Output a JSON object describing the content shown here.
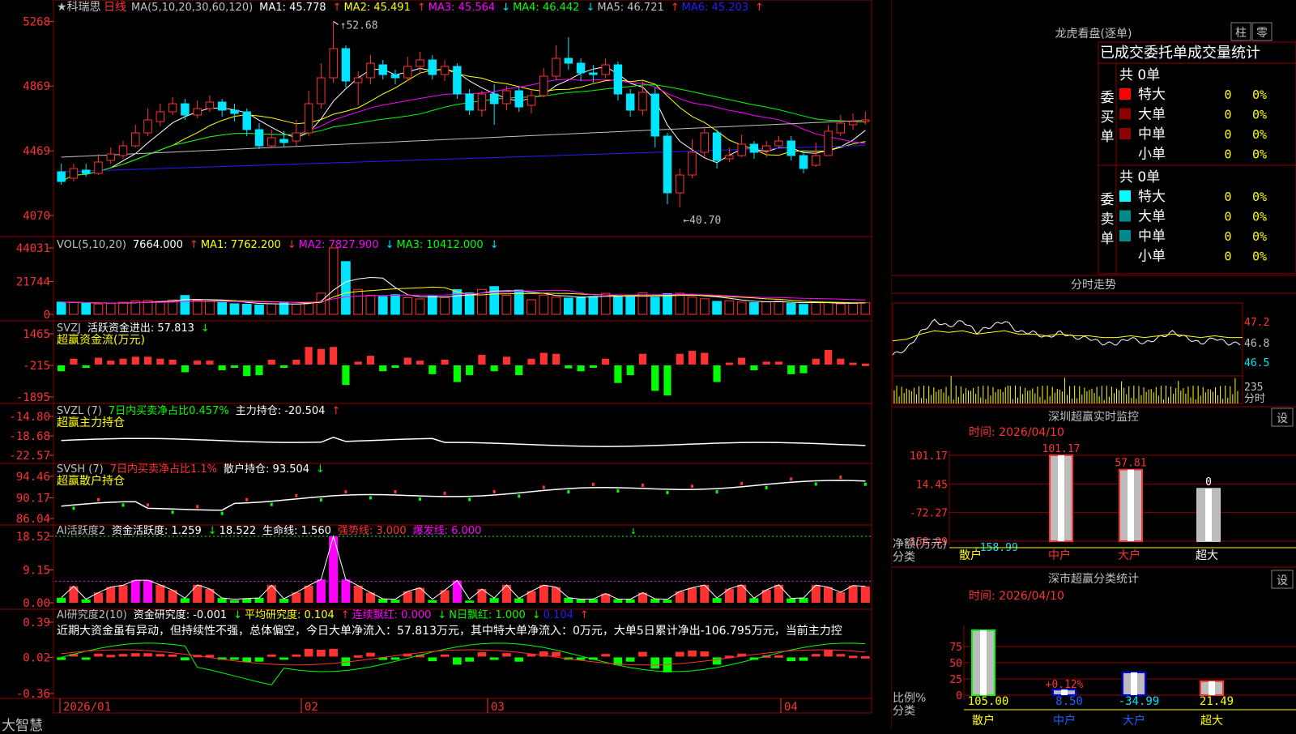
{
  "stock": {
    "name": "★科瑞思",
    "period": "日线"
  },
  "brand": "大智慧",
  "colors": {
    "up": "#ff3232",
    "down": "#00e5ff",
    "ma1": "#ffffff",
    "ma2": "#ffff00",
    "ma3": "#ff00ff",
    "ma4": "#00ff00",
    "ma5": "#c0c0c0",
    "ma6": "#2020ff",
    "grid": "#8b0000",
    "axis": "#ff3232",
    "yellow": "#ffff00",
    "green": "#00ff00"
  },
  "price_panel": {
    "legend": [
      "MA(5,10,20,30,60,120)",
      "MA1: 45.778",
      "↑",
      "MA2: 45.491",
      "↑",
      "MA3: 45.564",
      "↓",
      "MA4: 46.442",
      "↓",
      "MA5: 46.721",
      "↑",
      "MA6: 45.203",
      "↑"
    ],
    "ticks": [
      "5268",
      "4869",
      "4469",
      "4070"
    ],
    "high_label": "52.68",
    "low_label": "40.70"
  },
  "vol_panel": {
    "legend": [
      "VOL(5,10,20)",
      "7664.000",
      "↑",
      "MA1: 7762.200",
      "↓",
      "MA2: 7827.900",
      "↓",
      "MA3: 10412.000",
      "↓"
    ],
    "ticks": [
      "44031",
      "21744",
      "0"
    ]
  },
  "svzj_panel": {
    "legend": [
      "SVZJ",
      "活跃资金进出: 57.813",
      "↓"
    ],
    "sub": "超赢资金流(万元)",
    "ticks": [
      "1465",
      "-215",
      "-1895"
    ]
  },
  "svzl_panel": {
    "legend": [
      "SVZL (7)",
      "7日内买卖净占比0.457%",
      "主力持仓: -20.504",
      "↑"
    ],
    "sub": "超赢主力持仓",
    "ticks": [
      "-14.80",
      "-18.68",
      "-22.57"
    ]
  },
  "svsh_panel": {
    "legend": [
      "SVSH (7)",
      "7日内买卖净占比1.1%",
      "散户持仓: 93.504",
      "↓"
    ],
    "sub": "超赢散户持仓",
    "ticks": [
      "94.46",
      "90.17",
      "86.04"
    ]
  },
  "ai_panel": {
    "legend": [
      "AI活跃度2",
      "资金活跃度: 1.259",
      "↓",
      "18.522",
      "生命线: 1.560",
      "强势线: 3.000",
      "爆发线: 6.000"
    ],
    "ticks": [
      "18.52",
      "9.15",
      "0.00"
    ]
  },
  "research_panel": {
    "legend": [
      "AI研究度2(10)",
      "资金研究度: -0.001",
      "↓",
      "平均研究度: 0.104",
      "↑",
      "连续飘红: 0.000",
      "↓",
      "N日飘红: 1.000",
      "↓",
      "0.104",
      "↑"
    ],
    "comment": "近期大资金虽有异动，但持续性不强，总体偏空，今日大单净流入：57.813万元，其中特大单净流入：0万元，大单5日累计净出-106.795万元，当前主力控",
    "ticks": [
      "0.39",
      "0.02",
      "-0.36"
    ]
  },
  "xaxis": [
    "2026/01",
    "02",
    "03",
    "04"
  ],
  "lhkp": {
    "title": "龙虎看盘(逐单)",
    "btns": [
      "柱",
      "零"
    ],
    "subtitle": "已成交委托单成交量统计",
    "buy_label": [
      "委",
      "买",
      "单"
    ],
    "sell_label": [
      "委",
      "卖",
      "单"
    ],
    "buy_total": "共 0单",
    "sell_total": "共 0单",
    "buy_rows": [
      {
        "name": "特大",
        "val": "0",
        "pct": "0%",
        "color": "#ff0000"
      },
      {
        "name": "大单",
        "val": "0",
        "pct": "0%",
        "color": "#8b0000"
      },
      {
        "name": "中单",
        "val": "0",
        "pct": "0%",
        "color": "#8b0000"
      },
      {
        "name": "小单",
        "val": "0",
        "pct": "0%",
        "color": ""
      }
    ],
    "sell_rows": [
      {
        "name": "特大",
        "val": "0",
        "pct": "0%",
        "color": "#00ffff"
      },
      {
        "name": "大单",
        "val": "0",
        "pct": "0%",
        "color": "#008b8b"
      },
      {
        "name": "中单",
        "val": "0",
        "pct": "0%",
        "color": "#008b8b"
      },
      {
        "name": "小单",
        "val": "0",
        "pct": "0%",
        "color": ""
      }
    ]
  },
  "fenshi": {
    "title": "分时走势",
    "ticks": [
      "47.2",
      "46.8",
      "46.5"
    ],
    "vol_tick": "235",
    "vol_unit": "分时"
  },
  "monitor": {
    "title": "深圳超赢实时监控",
    "set": "设",
    "time": "时间: 2026/04/10",
    "ticks": [
      "101.17",
      "14.45",
      "-72.27",
      "-158.99"
    ],
    "ylabel": "净额(万元)",
    "xlabel": "分类",
    "cats": [
      "散户",
      "中户",
      "大户",
      "超大"
    ],
    "values": [
      -158.99,
      101.17,
      57.81,
      0
    ],
    "labels": [
      "-158.99",
      "101.17",
      "57.81",
      "0"
    ]
  },
  "classify": {
    "title": "深市超赢分类统计",
    "set": "设",
    "time": "时间: 2026/04/10",
    "ticks": [
      "75",
      "50",
      "25",
      "0"
    ],
    "ylabel": "比例%",
    "xlabel": "分类",
    "cats": [
      "散户",
      "中户",
      "大户",
      "超大"
    ],
    "values": [
      105.0,
      8.5,
      -34.99,
      21.49
    ],
    "labels": [
      "105.00",
      "8.50",
      "-34.99",
      "21.49"
    ],
    "mid_label": "+0.12%"
  },
  "chart_data": [
    {
      "type": "candlestick",
      "title": "科瑞思 日线",
      "ylim": [
        40.0,
        53.0
      ],
      "x": [
        "2026/01",
        "02",
        "03",
        "04"
      ],
      "candles": [
        [
          43.4,
          42.8,
          43.9,
          42.6
        ],
        [
          43.0,
          43.6,
          43.9,
          42.8
        ],
        [
          43.5,
          43.3,
          43.9,
          43.1
        ],
        [
          43.3,
          44.0,
          44.5,
          43.2
        ],
        [
          44.1,
          44.5,
          44.9,
          43.9
        ],
        [
          44.4,
          45.0,
          45.3,
          44.2
        ],
        [
          45.0,
          45.8,
          46.3,
          44.9
        ],
        [
          45.8,
          46.6,
          47.3,
          45.6
        ],
        [
          46.5,
          47.1,
          47.6,
          46.2
        ],
        [
          47.1,
          47.6,
          48.0,
          46.9
        ],
        [
          47.6,
          46.9,
          47.9,
          46.6
        ],
        [
          46.9,
          47.3,
          47.8,
          46.7
        ],
        [
          47.3,
          47.7,
          48.1,
          47.1
        ],
        [
          47.7,
          47.2,
          47.9,
          46.8
        ],
        [
          47.2,
          47.0,
          47.6,
          46.5
        ],
        [
          47.1,
          46.0,
          47.3,
          45.6
        ],
        [
          46.0,
          45.0,
          46.4,
          44.8
        ],
        [
          45.0,
          45.5,
          46.0,
          44.9
        ],
        [
          45.4,
          45.2,
          45.9,
          44.9
        ],
        [
          45.3,
          45.8,
          46.6,
          45.0
        ],
        [
          45.8,
          47.6,
          48.4,
          45.6
        ],
        [
          47.6,
          49.2,
          50.1,
          47.3
        ],
        [
          49.2,
          51.0,
          52.68,
          48.9
        ],
        [
          51.0,
          49.0,
          51.2,
          48.6
        ],
        [
          48.9,
          49.2,
          49.6,
          47.5
        ],
        [
          49.2,
          50.1,
          50.6,
          48.8
        ],
        [
          50.0,
          49.4,
          50.3,
          49.1
        ],
        [
          49.4,
          49.2,
          49.7,
          48.8
        ],
        [
          49.2,
          49.9,
          50.5,
          49.0
        ],
        [
          49.9,
          50.3,
          50.8,
          49.5
        ],
        [
          50.3,
          49.4,
          50.6,
          49.1
        ],
        [
          49.4,
          49.9,
          50.3,
          49.0
        ],
        [
          49.9,
          48.2,
          50.1,
          47.9
        ],
        [
          48.2,
          47.2,
          48.5,
          46.9
        ],
        [
          47.2,
          48.2,
          48.4,
          46.8
        ],
        [
          48.2,
          47.6,
          48.8,
          46.3
        ],
        [
          47.6,
          48.4,
          48.7,
          47.2
        ],
        [
          48.4,
          47.4,
          48.6,
          47.1
        ],
        [
          47.5,
          48.1,
          48.5,
          47.0
        ],
        [
          48.1,
          49.3,
          49.8,
          48.0
        ],
        [
          49.3,
          50.4,
          51.2,
          49.1
        ],
        [
          50.4,
          50.1,
          51.7,
          49.7
        ],
        [
          50.1,
          49.5,
          50.4,
          49.0
        ],
        [
          49.5,
          49.4,
          50.0,
          48.9
        ],
        [
          49.4,
          50.0,
          50.4,
          49.2
        ],
        [
          50.0,
          48.2,
          50.2,
          47.8
        ],
        [
          48.2,
          47.2,
          48.5,
          46.8
        ],
        [
          47.2,
          48.3,
          49.0,
          46.9
        ],
        [
          48.2,
          45.6,
          48.6,
          44.9
        ],
        [
          45.6,
          42.1,
          45.8,
          41.4
        ],
        [
          42.1,
          43.2,
          43.6,
          41.2
        ],
        [
          43.2,
          44.6,
          45.4,
          43.0
        ],
        [
          44.6,
          45.8,
          46.2,
          44.3
        ],
        [
          45.8,
          44.1,
          46.0,
          43.6
        ],
        [
          44.2,
          44.4,
          44.9,
          44.0
        ],
        [
          44.4,
          45.1,
          45.7,
          44.3
        ],
        [
          45.1,
          44.6,
          45.3,
          44.2
        ],
        [
          44.7,
          45.0,
          45.3,
          44.3
        ],
        [
          45.0,
          45.3,
          45.6,
          44.9
        ],
        [
          45.3,
          44.4,
          45.6,
          44.1
        ],
        [
          44.4,
          43.6,
          44.7,
          43.3
        ],
        [
          43.8,
          44.4,
          45.2,
          43.7
        ],
        [
          44.4,
          45.9,
          46.3,
          44.4
        ],
        [
          45.8,
          46.4,
          46.9,
          45.6
        ],
        [
          46.3,
          46.5,
          47.0,
          46.0
        ],
        [
          46.5,
          46.6,
          47.1,
          46.3
        ]
      ],
      "ma": [
        {
          "name": "MA1",
          "values": [
            43.2,
            43.3,
            43.4,
            43.7,
            44.0,
            44.5,
            44.9,
            45.5,
            46.2,
            46.9,
            47.2,
            47.4,
            47.5,
            47.3,
            47.0,
            46.6,
            46.2,
            46.0,
            45.6,
            45.6,
            46.0,
            47.2,
            48.6,
            49.2,
            49.6,
            49.5,
            49.3,
            49.4,
            49.6,
            49.6,
            49.7,
            49.6,
            49.2,
            48.6,
            48.1,
            47.9,
            47.9,
            47.9,
            47.9,
            48.4,
            49.0,
            49.3,
            49.5,
            49.7,
            49.9,
            49.5,
            48.9,
            48.6,
            47.5,
            46.0,
            44.6,
            44.0,
            43.7,
            44.2,
            44.6,
            44.9,
            45.0,
            44.8,
            44.9,
            44.8,
            44.6,
            44.6,
            45.0,
            45.3,
            45.8,
            46.3
          ]
        }
      ]
    },
    {
      "type": "bar",
      "title": "VOL",
      "values": [
        8100,
        7800,
        7500,
        6900,
        7200,
        8000,
        8900,
        9200,
        8600,
        9600,
        12500,
        9400,
        8600,
        7800,
        7000,
        6700,
        6200,
        7100,
        7500,
        6800,
        7800,
        14000,
        44031,
        35000,
        16500,
        12600,
        11800,
        13000,
        11000,
        10200,
        12100,
        11200,
        16400,
        14200,
        16500,
        18400,
        12600,
        16100,
        9600,
        12800,
        11400,
        10800,
        11600,
        11900,
        13900,
        11900,
        12400,
        14200,
        11400,
        13700,
        14000,
        11500,
        10300,
        8600,
        9000,
        8100,
        7800,
        8200,
        8800,
        7300,
        6600,
        8100,
        7800,
        7000,
        7200,
        7664
      ]
    },
    {
      "type": "line",
      "title": "分时走势",
      "ylim": [
        46.4,
        47.4
      ],
      "values": [
        46.6,
        46.7,
        47.0,
        47.2,
        47.1,
        47.2,
        47.0,
        47.1,
        47.2,
        47.0,
        47.0,
        46.9,
        47.0,
        46.9,
        46.9,
        46.8,
        46.8,
        46.9,
        46.8,
        46.9,
        47.0,
        46.9,
        46.8,
        46.9,
        46.8,
        46.8
      ]
    }
  ]
}
